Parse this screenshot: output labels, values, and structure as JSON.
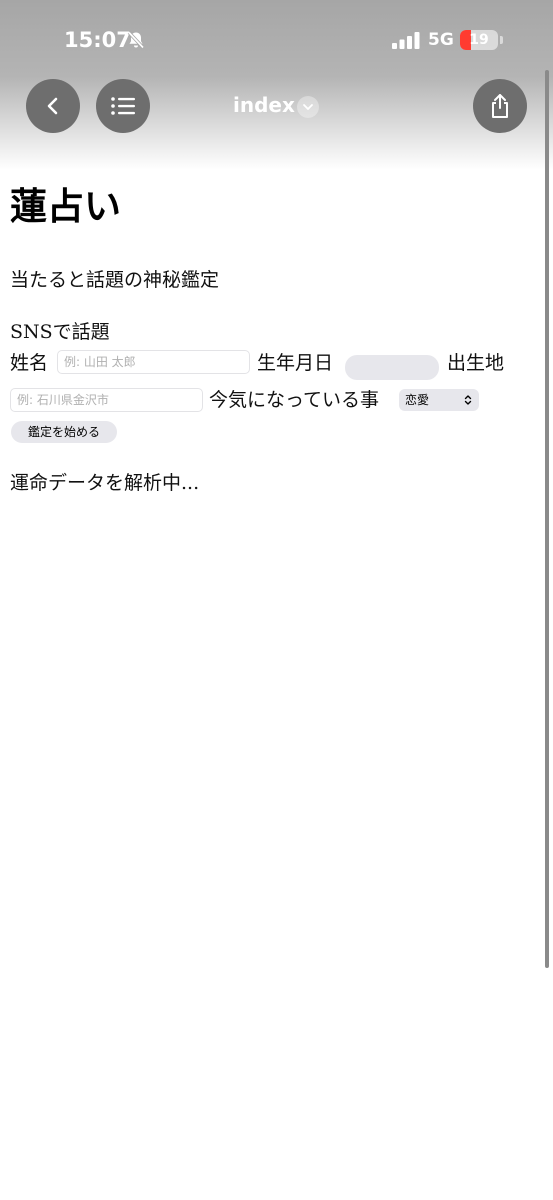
{
  "status_bar": {
    "time": "15:07",
    "network": "5G",
    "battery": "19",
    "battery_color": "#ff3b30"
  },
  "browser_bar": {
    "title": "index",
    "icons": [
      "back-icon",
      "list-icon",
      "chevron-down-icon",
      "share-icon"
    ]
  },
  "page": {
    "heading": "蓮占い",
    "subtitle": "当たると話題の神秘鑑定",
    "sns": "SNSで話題",
    "form": {
      "name_label": "姓名",
      "name_placeholder": "例: 山田 太郎",
      "birth_label": "生年月日",
      "birthplace_label": "出生地",
      "birthplace_placeholder": "例: 石川県金沢市",
      "concern_label": "今気になっている事",
      "concern_selected": "恋愛",
      "start_button": "鑑定を始める"
    },
    "loading_text": "運命データを解析中..."
  }
}
